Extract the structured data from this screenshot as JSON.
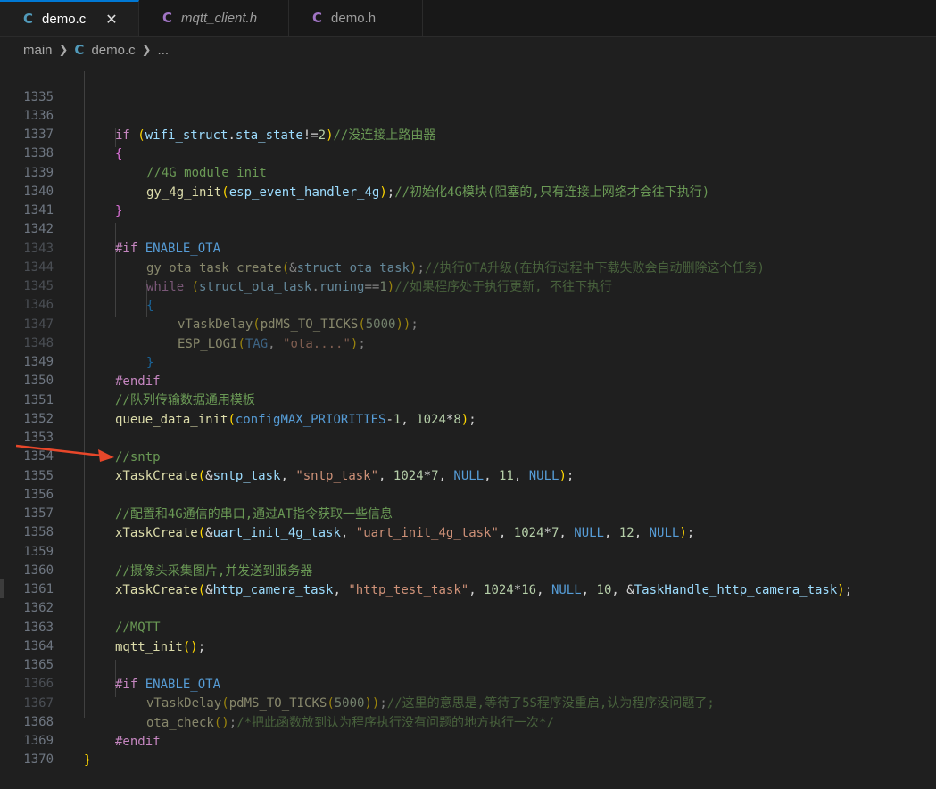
{
  "tabs": [
    {
      "icon": "C",
      "label": "demo.c",
      "active": true,
      "close": "✕"
    },
    {
      "icon": "C",
      "label": "mqtt_client.h",
      "active": false
    },
    {
      "icon": "C",
      "label": "demo.h",
      "active": false
    }
  ],
  "breadcrumb": {
    "root": "main",
    "icon": "C",
    "file": "demo.c",
    "more": "..."
  },
  "colors": {
    "accent": "#0078d4",
    "c_icon": "#519aba",
    "h_icon": "#a074c4",
    "arrow": "#e8472a"
  },
  "lines": [
    {
      "n": "1335",
      "code": ""
    },
    {
      "n": "1336",
      "code": "if (wifi_struct.sta_state!=2)//没连接上路由器"
    },
    {
      "n": "1337",
      "code": "{"
    },
    {
      "n": "1338",
      "code": "//4G module init"
    },
    {
      "n": "1339",
      "code": "gy_4g_init(esp_event_handler_4g);//初始化4G模块(阻塞的,只有连接上网络才会往下执行)"
    },
    {
      "n": "1340",
      "code": "}"
    },
    {
      "n": "1341",
      "code": ""
    },
    {
      "n": "1342",
      "code": "#if ENABLE_OTA"
    },
    {
      "n": "1343",
      "code": "gy_ota_task_create(&struct_ota_task);//执行OTA升级(在执行过程中下载失败会自动删除这个任务)"
    },
    {
      "n": "1344",
      "code": "while (struct_ota_task.runing==1)//如果程序处于执行更新, 不往下执行"
    },
    {
      "n": "1345",
      "code": "{"
    },
    {
      "n": "1346",
      "code": "vTaskDelay(pdMS_TO_TICKS(5000));"
    },
    {
      "n": "1347",
      "code": "ESP_LOGI(TAG, \"ota....\");"
    },
    {
      "n": "1348",
      "code": "}"
    },
    {
      "n": "1349",
      "code": "#endif"
    },
    {
      "n": "1350",
      "code": "//队列传输数据通用模板"
    },
    {
      "n": "1351",
      "code": "queue_data_init(configMAX_PRIORITIES-1, 1024*8);"
    },
    {
      "n": "1352",
      "code": ""
    },
    {
      "n": "1353",
      "code": "//sntp"
    },
    {
      "n": "1354",
      "code": "xTaskCreate(&sntp_task, \"sntp_task\", 1024*7, NULL, 11, NULL);"
    },
    {
      "n": "1355",
      "code": ""
    },
    {
      "n": "1356",
      "code": "//配置和4G通信的串口,通过AT指令获取一些信息"
    },
    {
      "n": "1357",
      "code": "xTaskCreate(&uart_init_4g_task, \"uart_init_4g_task\", 1024*7, NULL, 12, NULL);"
    },
    {
      "n": "1358",
      "code": ""
    },
    {
      "n": "1359",
      "code": "//摄像头采集图片,并发送到服务器"
    },
    {
      "n": "1360",
      "code": "xTaskCreate(&http_camera_task, \"http_test_task\", 1024*16, NULL, 10, &TaskHandle_http_camera_task);"
    },
    {
      "n": "1361",
      "code": ""
    },
    {
      "n": "1362",
      "code": "//MQTT"
    },
    {
      "n": "1363",
      "code": "mqtt_init();"
    },
    {
      "n": "1364",
      "code": ""
    },
    {
      "n": "1365",
      "code": "#if ENABLE_OTA"
    },
    {
      "n": "1366",
      "code": "vTaskDelay(pdMS_TO_TICKS(5000));//这里的意思是,等待了5S程序没重启,认为程序没问题了;"
    },
    {
      "n": "1367",
      "code": "ota_check();/*把此函数放到认为程序执行没有问题的地方执行一次*/"
    },
    {
      "n": "1368",
      "code": "#endif"
    },
    {
      "n": "1369",
      "code": "}"
    },
    {
      "n": "1370",
      "code": ""
    }
  ]
}
